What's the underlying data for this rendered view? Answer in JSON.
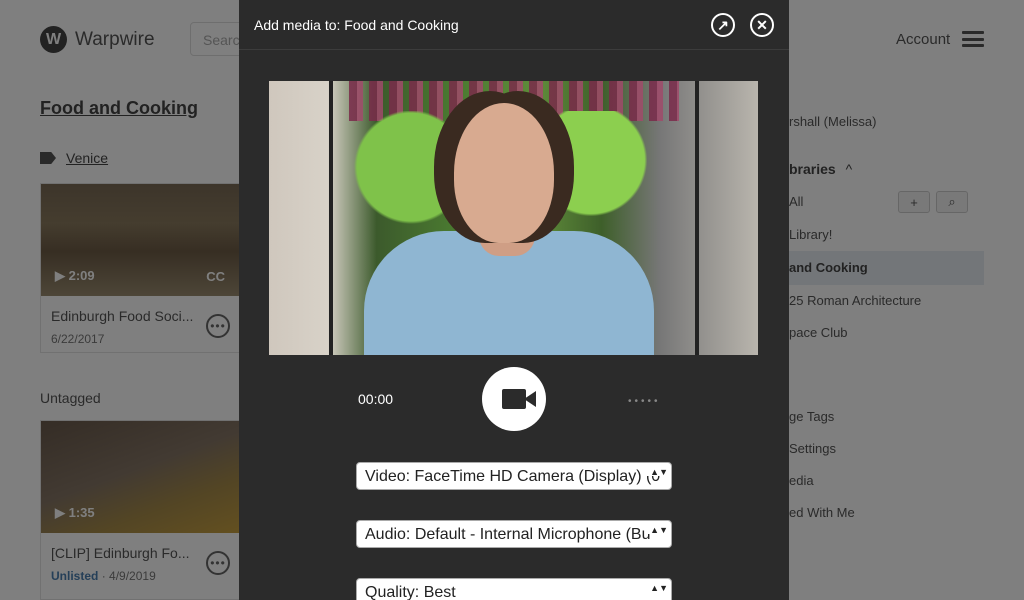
{
  "background": {
    "logo_letter": "W",
    "logo_text": "Warpwire",
    "search_placeholder": "Search",
    "account_label": "Account",
    "library_title": "Food and Cooking",
    "tag_label": "Venice",
    "untagged_label": "Untagged",
    "cards": [
      {
        "duration": "▶ 2:09",
        "cc": "CC",
        "title": "Edinburgh Food Soci...",
        "date": "6/22/2017",
        "status": ""
      },
      {
        "duration": "▶ 1:35",
        "cc": "",
        "title": "[CLIP] Edinburgh Fo...",
        "date": "4/9/2019",
        "status": "Unlisted"
      }
    ],
    "more_glyph": "•••",
    "sidebar": {
      "user": "rshall (Melissa)",
      "libraries_heading": "braries",
      "libraries_chevron": "^",
      "all": "All",
      "add_glyph": "+",
      "search_glyph": "⌕",
      "items": [
        "Library!",
        "and Cooking",
        "25 Roman Architecture",
        "pace Club"
      ],
      "settings_items": [
        "ge Tags",
        "Settings",
        "edia",
        "ed With Me"
      ]
    }
  },
  "modal": {
    "title": "Add media to: Food and Cooking",
    "popout_glyph": "↗",
    "close_glyph": "✕",
    "timer": "00:00",
    "level_dots": "•••••",
    "video_select": "Video: FaceTime HD Camera (Display) (0",
    "audio_select": "Audio: Default - Internal Microphone (Bu",
    "quality_select": "Quality: Best",
    "select_arrows": "▲▼"
  }
}
